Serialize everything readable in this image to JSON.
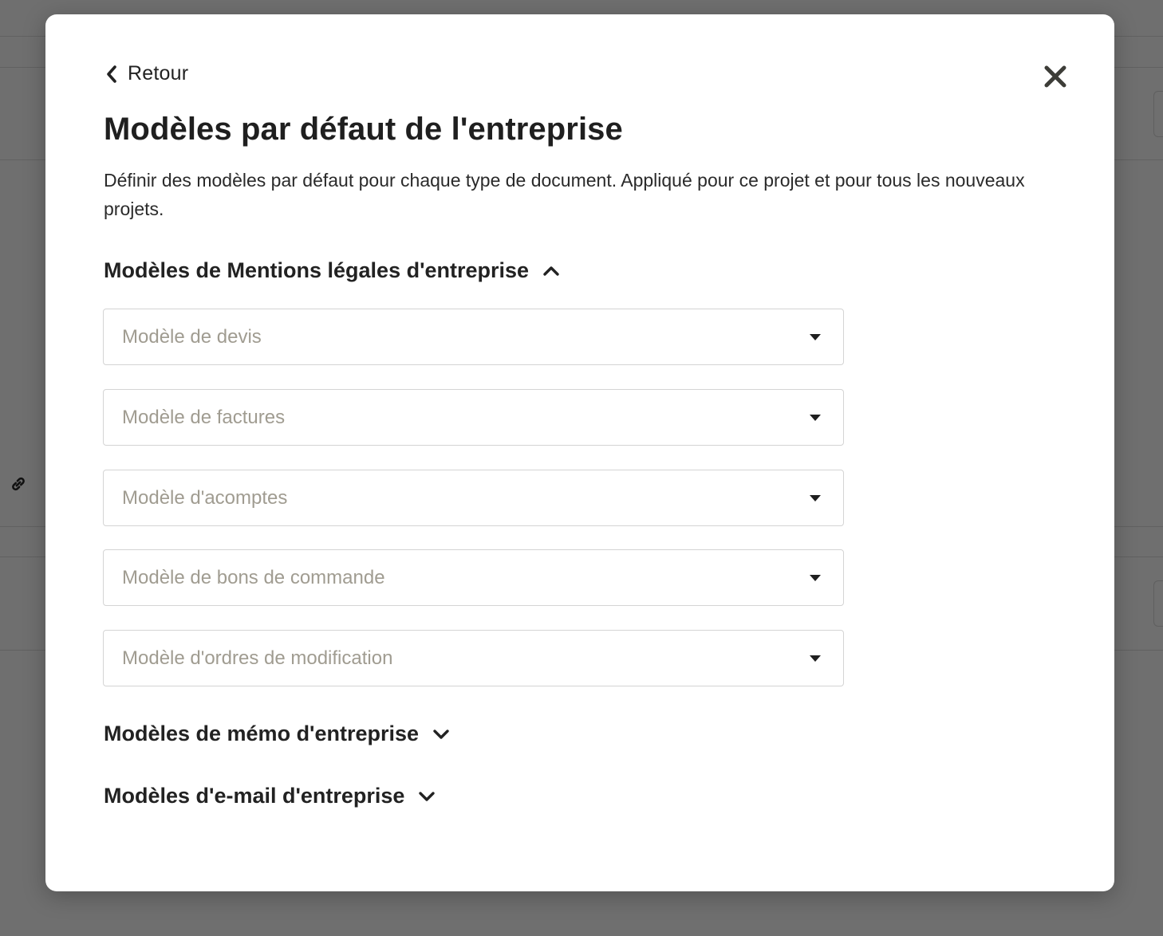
{
  "modal": {
    "back_label": "Retour",
    "close_icon": "close-icon",
    "title": "Modèles par défaut de l'entreprise",
    "description": "Définir des modèles par défaut pour chaque type de document. Appliqué pour ce projet et pour tous les nouveaux projets."
  },
  "sections": {
    "legal": {
      "title": "Modèles de Mentions légales d'entreprise",
      "expanded": true,
      "fields": [
        {
          "placeholder": "Modèle de devis"
        },
        {
          "placeholder": "Modèle de factures"
        },
        {
          "placeholder": "Modèle d'acomptes"
        },
        {
          "placeholder": "Modèle de bons de commande"
        },
        {
          "placeholder": "Modèle d'ordres de modification"
        }
      ]
    },
    "memo": {
      "title": "Modèles de mémo d'entreprise",
      "expanded": false
    },
    "email": {
      "title": "Modèles d'e-mail d'entreprise",
      "expanded": false
    }
  },
  "colors": {
    "placeholder": "#a09c91",
    "border": "#d4d4d4",
    "overlay": "#6f6f6f"
  }
}
